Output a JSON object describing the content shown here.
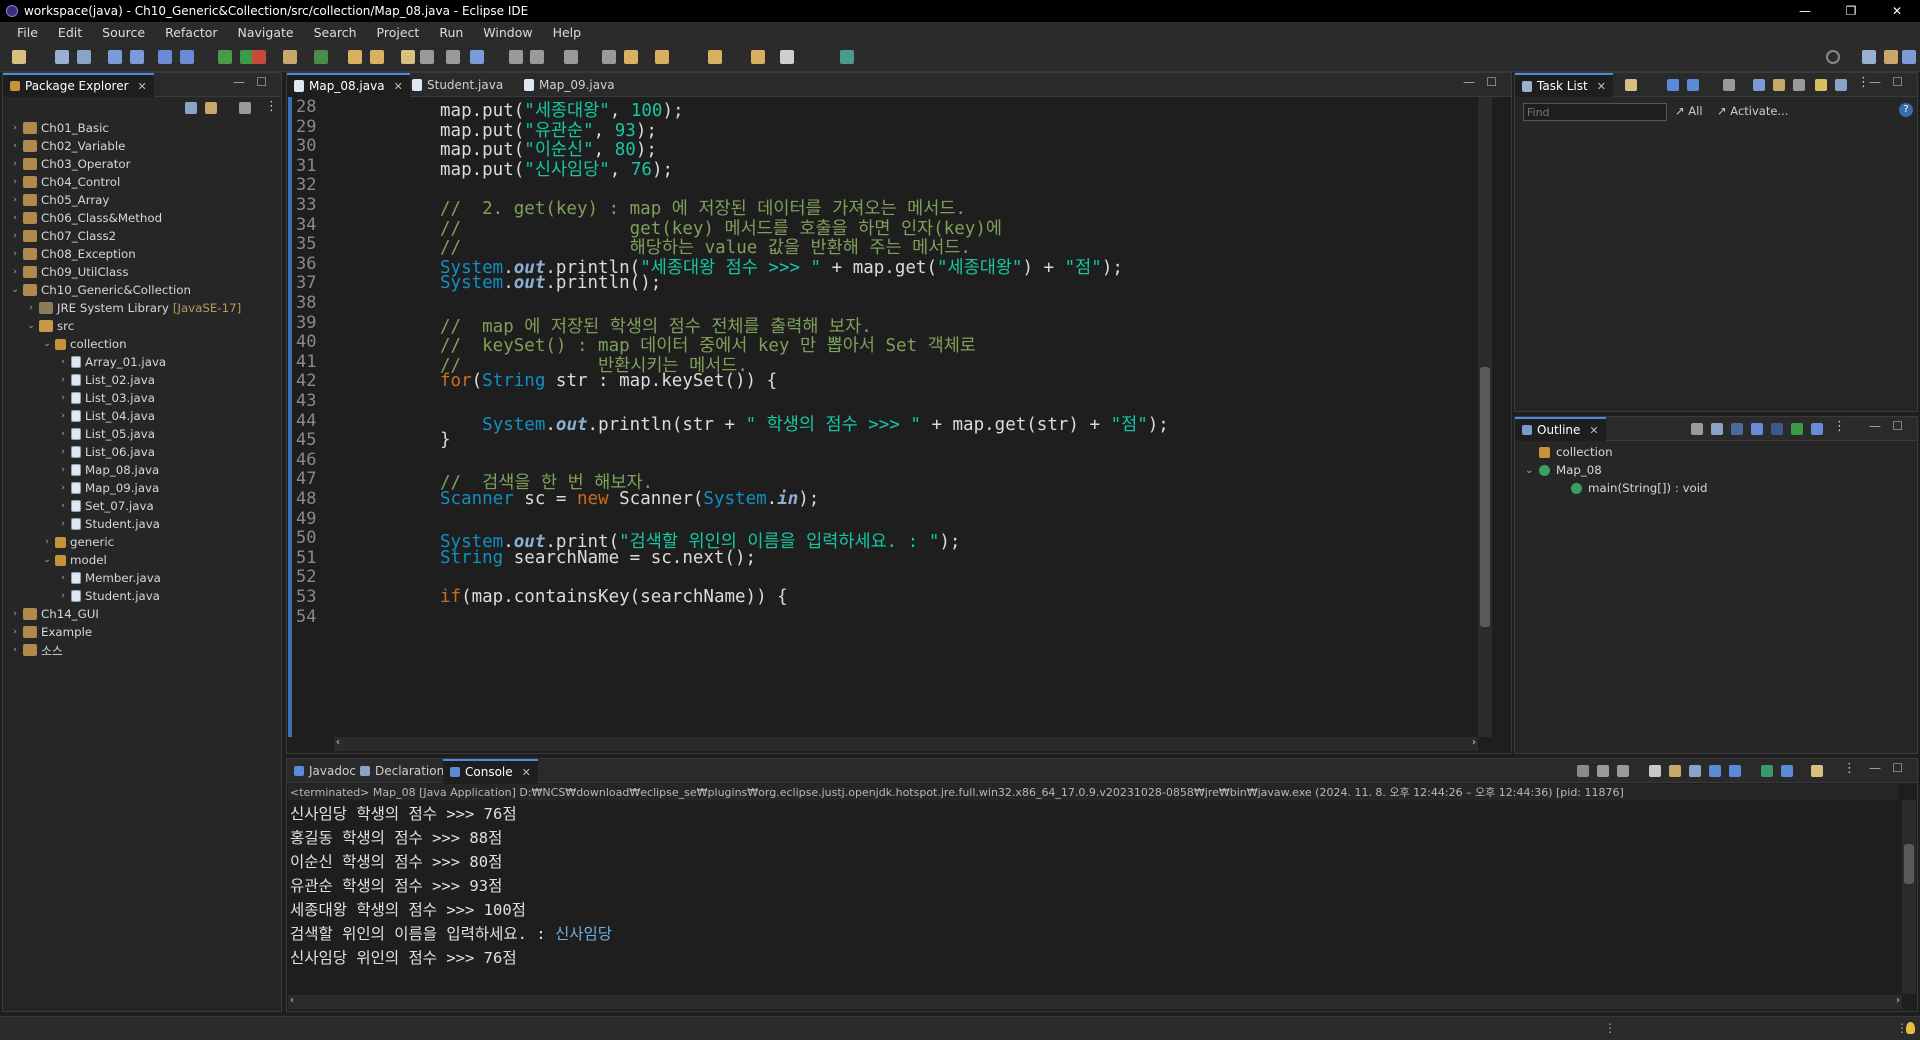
{
  "window": {
    "title": "workspace(java) - Ch10_Generic&Collection/src/collection/Map_08.java - Eclipse IDE",
    "minimize": "—",
    "maximize": "❐",
    "close": "✕"
  },
  "menu": [
    "File",
    "Edit",
    "Source",
    "Refactor",
    "Navigate",
    "Search",
    "Project",
    "Run",
    "Window",
    "Help"
  ],
  "package_explorer": {
    "tab": "Package Explorer",
    "items": [
      {
        "label": "Ch01_Basic",
        "depth": 0,
        "kind": "project",
        "arrow": "›"
      },
      {
        "label": "Ch02_Variable",
        "depth": 0,
        "kind": "project",
        "arrow": "›"
      },
      {
        "label": "Ch03_Operator",
        "depth": 0,
        "kind": "project",
        "arrow": "›"
      },
      {
        "label": "Ch04_Control",
        "depth": 0,
        "kind": "project",
        "arrow": "›"
      },
      {
        "label": "Ch05_Array",
        "depth": 0,
        "kind": "project",
        "arrow": "›"
      },
      {
        "label": "Ch06_Class&Method",
        "depth": 0,
        "kind": "project",
        "arrow": "›"
      },
      {
        "label": "Ch07_Class2",
        "depth": 0,
        "kind": "project",
        "arrow": "›"
      },
      {
        "label": "Ch08_Exception",
        "depth": 0,
        "kind": "project",
        "arrow": "›"
      },
      {
        "label": "Ch09_UtilClass",
        "depth": 0,
        "kind": "project",
        "arrow": "›"
      },
      {
        "label": "Ch10_Generic&Collection",
        "depth": 0,
        "kind": "project",
        "arrow": "⌄"
      },
      {
        "label": "JRE System Library",
        "extra": "[JavaSE-17]",
        "depth": 1,
        "kind": "jre",
        "arrow": "›"
      },
      {
        "label": "src",
        "depth": 1,
        "kind": "src",
        "arrow": "⌄"
      },
      {
        "label": "collection",
        "depth": 2,
        "kind": "pkg",
        "arrow": "⌄"
      },
      {
        "label": "Array_01.java",
        "depth": 3,
        "kind": "java",
        "arrow": "›"
      },
      {
        "label": "List_02.java",
        "depth": 3,
        "kind": "java",
        "arrow": "›"
      },
      {
        "label": "List_03.java",
        "depth": 3,
        "kind": "java",
        "arrow": "›"
      },
      {
        "label": "List_04.java",
        "depth": 3,
        "kind": "java",
        "arrow": "›"
      },
      {
        "label": "List_05.java",
        "depth": 3,
        "kind": "java",
        "arrow": "›"
      },
      {
        "label": "List_06.java",
        "depth": 3,
        "kind": "java",
        "arrow": "›"
      },
      {
        "label": "Map_08.java",
        "depth": 3,
        "kind": "java",
        "arrow": "›"
      },
      {
        "label": "Map_09.java",
        "depth": 3,
        "kind": "java",
        "arrow": "›"
      },
      {
        "label": "Set_07.java",
        "depth": 3,
        "kind": "java",
        "arrow": "›"
      },
      {
        "label": "Student.java",
        "depth": 3,
        "kind": "java",
        "arrow": "›"
      },
      {
        "label": "generic",
        "depth": 2,
        "kind": "pkg",
        "arrow": "›"
      },
      {
        "label": "model",
        "depth": 2,
        "kind": "pkg",
        "arrow": "⌄"
      },
      {
        "label": "Member.java",
        "depth": 3,
        "kind": "java",
        "arrow": "›"
      },
      {
        "label": "Student.java",
        "depth": 3,
        "kind": "java",
        "arrow": "›"
      },
      {
        "label": "Ch14_GUI",
        "depth": 0,
        "kind": "project",
        "arrow": "›"
      },
      {
        "label": "Example",
        "depth": 0,
        "kind": "project",
        "arrow": "›"
      },
      {
        "label": "소스",
        "depth": 0,
        "kind": "project",
        "arrow": "›"
      }
    ]
  },
  "editor": {
    "tabs": [
      {
        "label": "Map_08.java",
        "active": true,
        "close": "✕"
      },
      {
        "label": "Student.java",
        "active": false,
        "close": ""
      },
      {
        "label": "Map_09.java",
        "active": false,
        "close": ""
      }
    ],
    "lines": [
      {
        "n": "28",
        "tokens": [
          [
            "pl",
            "map.put("
          ],
          [
            "st",
            "\"세종대왕\""
          ],
          [
            "pl",
            ", "
          ],
          [
            "st",
            "100"
          ],
          [
            "pl",
            ");"
          ]
        ]
      },
      {
        "n": "29",
        "tokens": [
          [
            "pl",
            "map.put("
          ],
          [
            "st",
            "\"유관순\""
          ],
          [
            "pl",
            ", "
          ],
          [
            "st",
            "93"
          ],
          [
            "pl",
            ");"
          ]
        ]
      },
      {
        "n": "30",
        "tokens": [
          [
            "pl",
            "map.put("
          ],
          [
            "st",
            "\"이순신\""
          ],
          [
            "pl",
            ", "
          ],
          [
            "st",
            "80"
          ],
          [
            "pl",
            ");"
          ]
        ]
      },
      {
        "n": "31",
        "tokens": [
          [
            "pl",
            "map.put("
          ],
          [
            "st",
            "\"신사임당\""
          ],
          [
            "pl",
            ", "
          ],
          [
            "st",
            "76"
          ],
          [
            "pl",
            ");"
          ]
        ]
      },
      {
        "n": "32",
        "tokens": []
      },
      {
        "n": "33",
        "tokens": [
          [
            "cm",
            "//  2. get(key) : map 에 저장된 데이터를 가져오는 메서드."
          ]
        ]
      },
      {
        "n": "34",
        "tokens": [
          [
            "cm",
            "//                get(key) 메서드를 호출을 하면 인자(key)에"
          ]
        ]
      },
      {
        "n": "35",
        "tokens": [
          [
            "cm",
            "//                해당하는 value 값을 반환해 주는 메서드."
          ]
        ]
      },
      {
        "n": "36",
        "tokens": [
          [
            "ty",
            "System"
          ],
          [
            "pl",
            "."
          ],
          [
            "fd",
            "out"
          ],
          [
            "pl",
            ".println("
          ],
          [
            "st",
            "\"세종대왕 점수 >>> \""
          ],
          [
            "pl",
            " + map.get("
          ],
          [
            "st",
            "\"세종대왕\""
          ],
          [
            "pl",
            ") + "
          ],
          [
            "st",
            "\"점\""
          ],
          [
            "pl",
            ");"
          ]
        ]
      },
      {
        "n": "37",
        "tokens": [
          [
            "ty",
            "System"
          ],
          [
            "pl",
            "."
          ],
          [
            "fd",
            "out"
          ],
          [
            "pl",
            ".println();"
          ]
        ]
      },
      {
        "n": "38",
        "tokens": []
      },
      {
        "n": "39",
        "tokens": [
          [
            "cm",
            "//  map 에 저장된 학생의 점수 전체를 출력해 보자."
          ]
        ]
      },
      {
        "n": "40",
        "tokens": [
          [
            "cm",
            "//  keySet() : map 데이터 중에서 key 만 뽑아서 Set 객체로"
          ]
        ]
      },
      {
        "n": "41",
        "tokens": [
          [
            "cm",
            "//             반환시키는 메서드."
          ]
        ]
      },
      {
        "n": "42",
        "tokens": [
          [
            "k",
            "for"
          ],
          [
            "pl",
            "("
          ],
          [
            "ty",
            "String"
          ],
          [
            "pl",
            " str : map.keySet()) {"
          ]
        ]
      },
      {
        "n": "43",
        "tokens": []
      },
      {
        "n": "44",
        "tokens": [
          [
            "pl",
            "    "
          ],
          [
            "ty",
            "System"
          ],
          [
            "pl",
            "."
          ],
          [
            "fd",
            "out"
          ],
          [
            "pl",
            ".println(str + "
          ],
          [
            "st",
            "\" 학생의 점수 >>> \""
          ],
          [
            "pl",
            " + map.get(str) + "
          ],
          [
            "st",
            "\"점\""
          ],
          [
            "pl",
            ");"
          ]
        ]
      },
      {
        "n": "45",
        "tokens": [
          [
            "pl",
            "}"
          ]
        ]
      },
      {
        "n": "46",
        "tokens": []
      },
      {
        "n": "47",
        "tokens": [
          [
            "cm",
            "//  검색을 한 번 해보자."
          ]
        ]
      },
      {
        "n": "48",
        "tokens": [
          [
            "ty",
            "Scanner"
          ],
          [
            "pl",
            " sc = "
          ],
          [
            "k",
            "new"
          ],
          [
            "pl",
            " Scanner("
          ],
          [
            "ty",
            "System"
          ],
          [
            "pl",
            "."
          ],
          [
            "fd",
            "in"
          ],
          [
            "pl",
            ");"
          ]
        ]
      },
      {
        "n": "49",
        "tokens": []
      },
      {
        "n": "50",
        "tokens": [
          [
            "ty",
            "System"
          ],
          [
            "pl",
            "."
          ],
          [
            "fd",
            "out"
          ],
          [
            "pl",
            ".print("
          ],
          [
            "st",
            "\"검색할 위인의 이름을 입력하세요. : \""
          ],
          [
            "pl",
            ");"
          ]
        ]
      },
      {
        "n": "51",
        "tokens": [
          [
            "ty",
            "String"
          ],
          [
            "pl",
            " searchName = sc.next();"
          ]
        ]
      },
      {
        "n": "52",
        "tokens": []
      },
      {
        "n": "53",
        "tokens": [
          [
            "k",
            "if"
          ],
          [
            "pl",
            "(map.containsKey(searchName)) {"
          ]
        ]
      },
      {
        "n": "54",
        "tokens": []
      }
    ]
  },
  "task_list": {
    "tab": "Task List",
    "find_placeholder": "Find",
    "all": "All",
    "activate": "Activate..."
  },
  "outline": {
    "tab": "Outline",
    "items": [
      {
        "label": "collection",
        "depth": 0,
        "arrow": ""
      },
      {
        "label": "Map_08",
        "depth": 0,
        "arrow": "⌄"
      },
      {
        "label": "main(String[]) : void",
        "depth": 1,
        "arrow": ""
      }
    ]
  },
  "bottom_tabs": [
    {
      "label": "Javadoc",
      "active": false,
      "close": ""
    },
    {
      "label": "Declaration",
      "active": false,
      "close": ""
    },
    {
      "label": "Console",
      "active": true,
      "close": "✕"
    }
  ],
  "console": {
    "header": "<terminated> Map_08 [Java Application] D:₩NCS₩download₩eclipse_se₩plugins₩org.eclipse.justj.openjdk.hotspot.jre.full.win32.x86_64_17.0.9.v20231028-0858₩jre₩bin₩javaw.exe  (2024. 11. 8. 오후 12:44:26 – 오후 12:44:36) [pid: 11876]",
    "lines": [
      {
        "text": "신사임당 학생의 점수 >>> 76점",
        "input": ""
      },
      {
        "text": "홍길동 학생의 점수 >>> 88점",
        "input": ""
      },
      {
        "text": "이순신 학생의 점수 >>> 80점",
        "input": ""
      },
      {
        "text": "유관순 학생의 점수 >>> 93점",
        "input": ""
      },
      {
        "text": "세종대왕 학생의 점수 >>> 100점",
        "input": ""
      },
      {
        "text": "검색할 위인의 이름을 입력하세요. : ",
        "input": "신사임당"
      },
      {
        "text": "신사임당 위인의 점수 >>> 76점",
        "input": ""
      }
    ]
  },
  "colors": {
    "keyword": "#cc6c1d",
    "comment": "#7fa05a",
    "string": "#17c6a3",
    "type": "#1290c3",
    "field": "#8dafd3"
  }
}
